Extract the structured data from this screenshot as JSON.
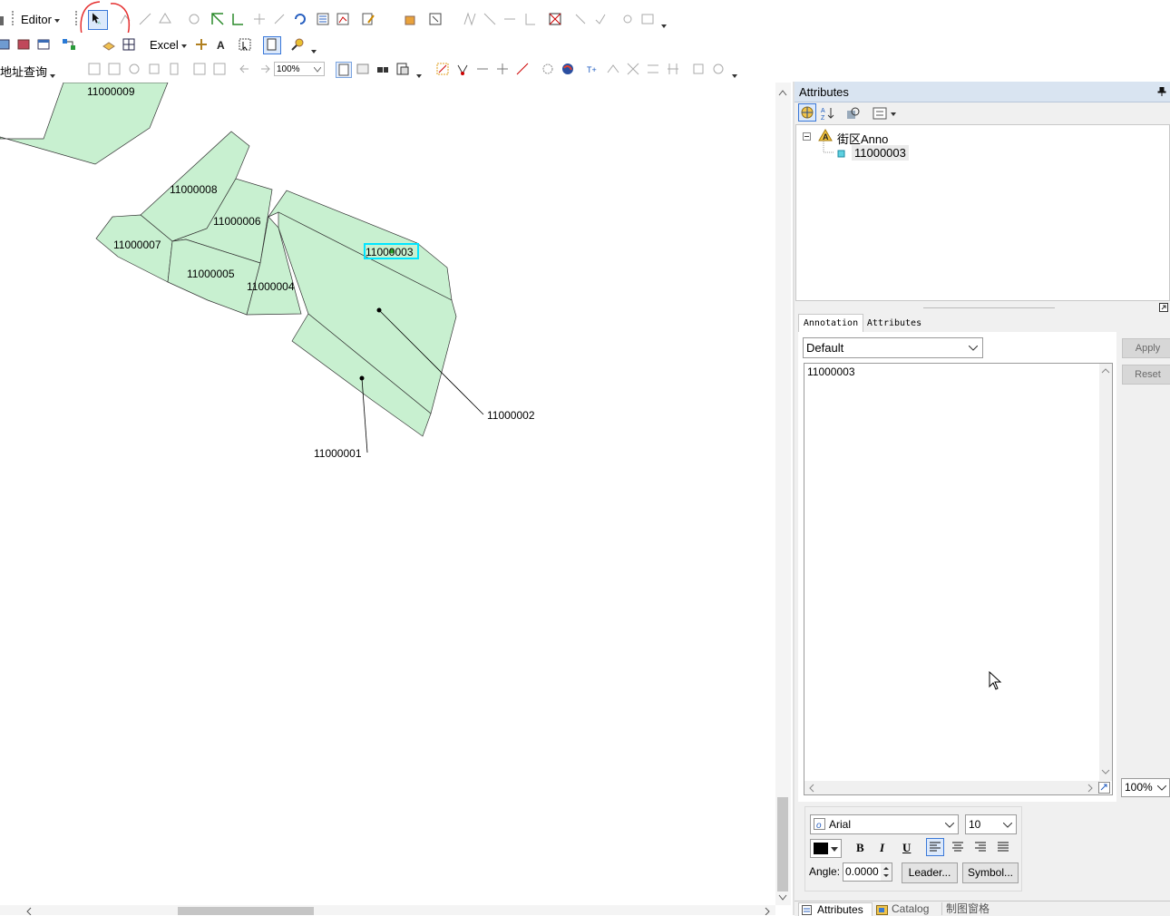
{
  "toolbar": {
    "editor_label": "Editor",
    "excel_label": "Excel",
    "address_query_label": "地址查询",
    "zoom_value": "100%"
  },
  "map": {
    "parcels": [
      {
        "id": "11000009"
      },
      {
        "id": "11000008"
      },
      {
        "id": "11000006"
      },
      {
        "id": "11000007"
      },
      {
        "id": "11000005"
      },
      {
        "id": "11000004"
      },
      {
        "id": "11000003"
      },
      {
        "id": "11000002"
      },
      {
        "id": "11000001"
      }
    ],
    "fill_color": "#c8f0d0",
    "selection_color": "#00e5ff"
  },
  "attributes_panel": {
    "title": "Attributes",
    "tree": {
      "layer_label": "街区Anno",
      "feature_label": "11000003"
    },
    "tabs": [
      "Annotation",
      "Attributes"
    ],
    "style_select": "Default",
    "text_value": "11000003",
    "apply_label": "Apply",
    "reset_label": "Reset",
    "zoom_select": "100%",
    "font_select": "Arial",
    "size_select": "10",
    "bold_label": "B",
    "italic_label": "I",
    "underline_label": "U",
    "angle_label": "Angle:",
    "angle_value": "0.0000",
    "leader_label": "Leader...",
    "symbol_label": "Symbol...",
    "bottom_tabs": [
      "Attributes",
      "Catalog",
      "制图窗格"
    ]
  }
}
